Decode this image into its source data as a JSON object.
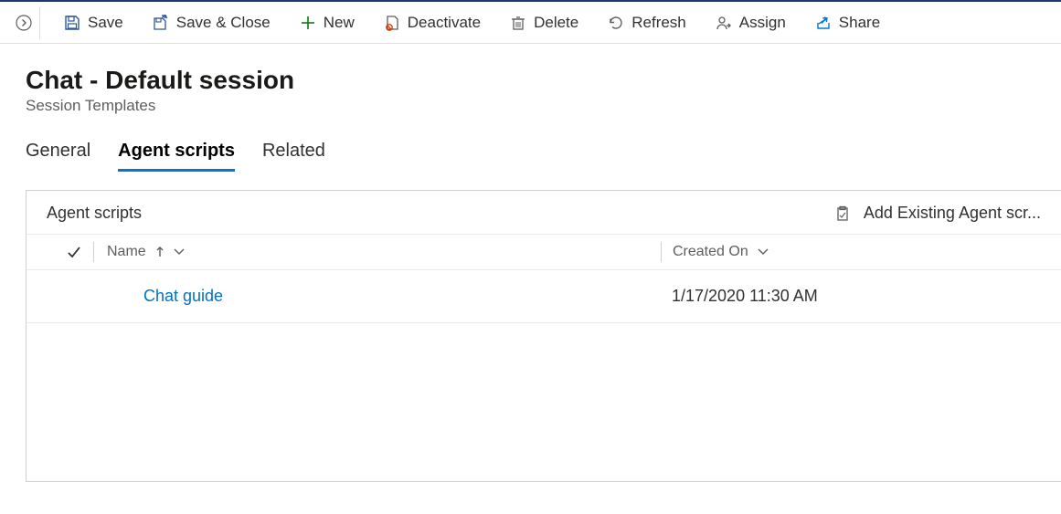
{
  "commands": {
    "save": "Save",
    "save_close": "Save & Close",
    "new": "New",
    "deactivate": "Deactivate",
    "delete": "Delete",
    "refresh": "Refresh",
    "assign": "Assign",
    "share": "Share"
  },
  "header": {
    "title": "Chat - Default session",
    "entity": "Session Templates"
  },
  "tabs": {
    "general": "General",
    "agent_scripts": "Agent scripts",
    "related": "Related"
  },
  "panel": {
    "title": "Agent scripts",
    "add_existing": "Add Existing Agent scr..."
  },
  "grid": {
    "columns": {
      "name": "Name",
      "created_on": "Created On"
    },
    "rows": [
      {
        "name": "Chat guide",
        "created_on": "1/17/2020 11:30 AM"
      }
    ]
  }
}
